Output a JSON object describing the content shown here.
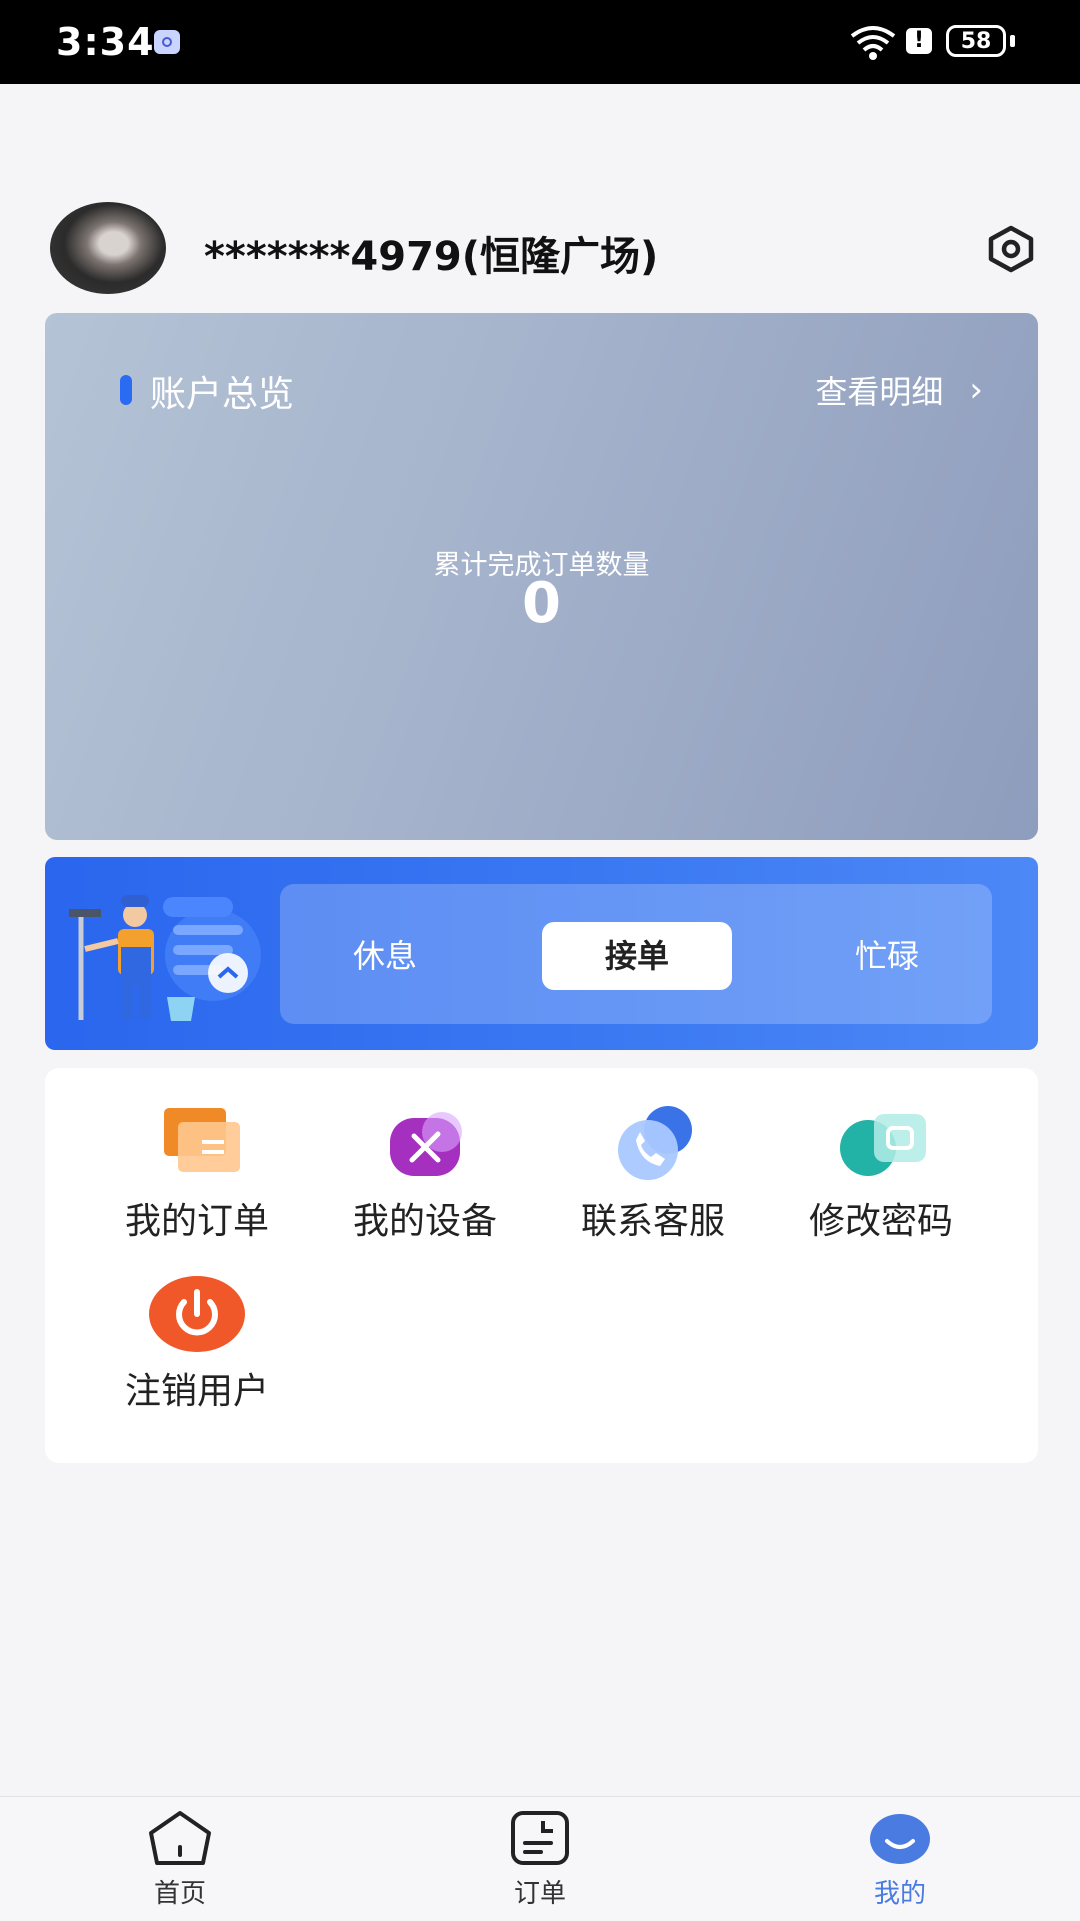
{
  "status_bar": {
    "time": "3:34",
    "battery": "58",
    "alert": "!"
  },
  "profile": {
    "username": "*******4979(恒隆广场)"
  },
  "overview": {
    "title": "账户总览",
    "detail_link": "查看明细",
    "stat_label": "累计完成订单数量",
    "stat_value": "0"
  },
  "work_status": {
    "options": [
      "休息",
      "接单",
      "忙碌"
    ],
    "selected": "接单"
  },
  "menu": {
    "items": [
      {
        "label": "我的订单",
        "icon": "orders-icon"
      },
      {
        "label": "我的设备",
        "icon": "tools-icon"
      },
      {
        "label": "联系客服",
        "icon": "phone-icon"
      },
      {
        "label": "修改密码",
        "icon": "password-icon"
      },
      {
        "label": "注销用户",
        "icon": "power-icon"
      }
    ]
  },
  "tabs": [
    {
      "label": "首页",
      "icon": "home-icon"
    },
    {
      "label": "订单",
      "icon": "order-list-icon"
    },
    {
      "label": "我的",
      "icon": "profile-icon"
    }
  ],
  "colors": {
    "accent": "#2b6bf3",
    "active_tab": "#4a7be0",
    "power": "#f0582a"
  }
}
